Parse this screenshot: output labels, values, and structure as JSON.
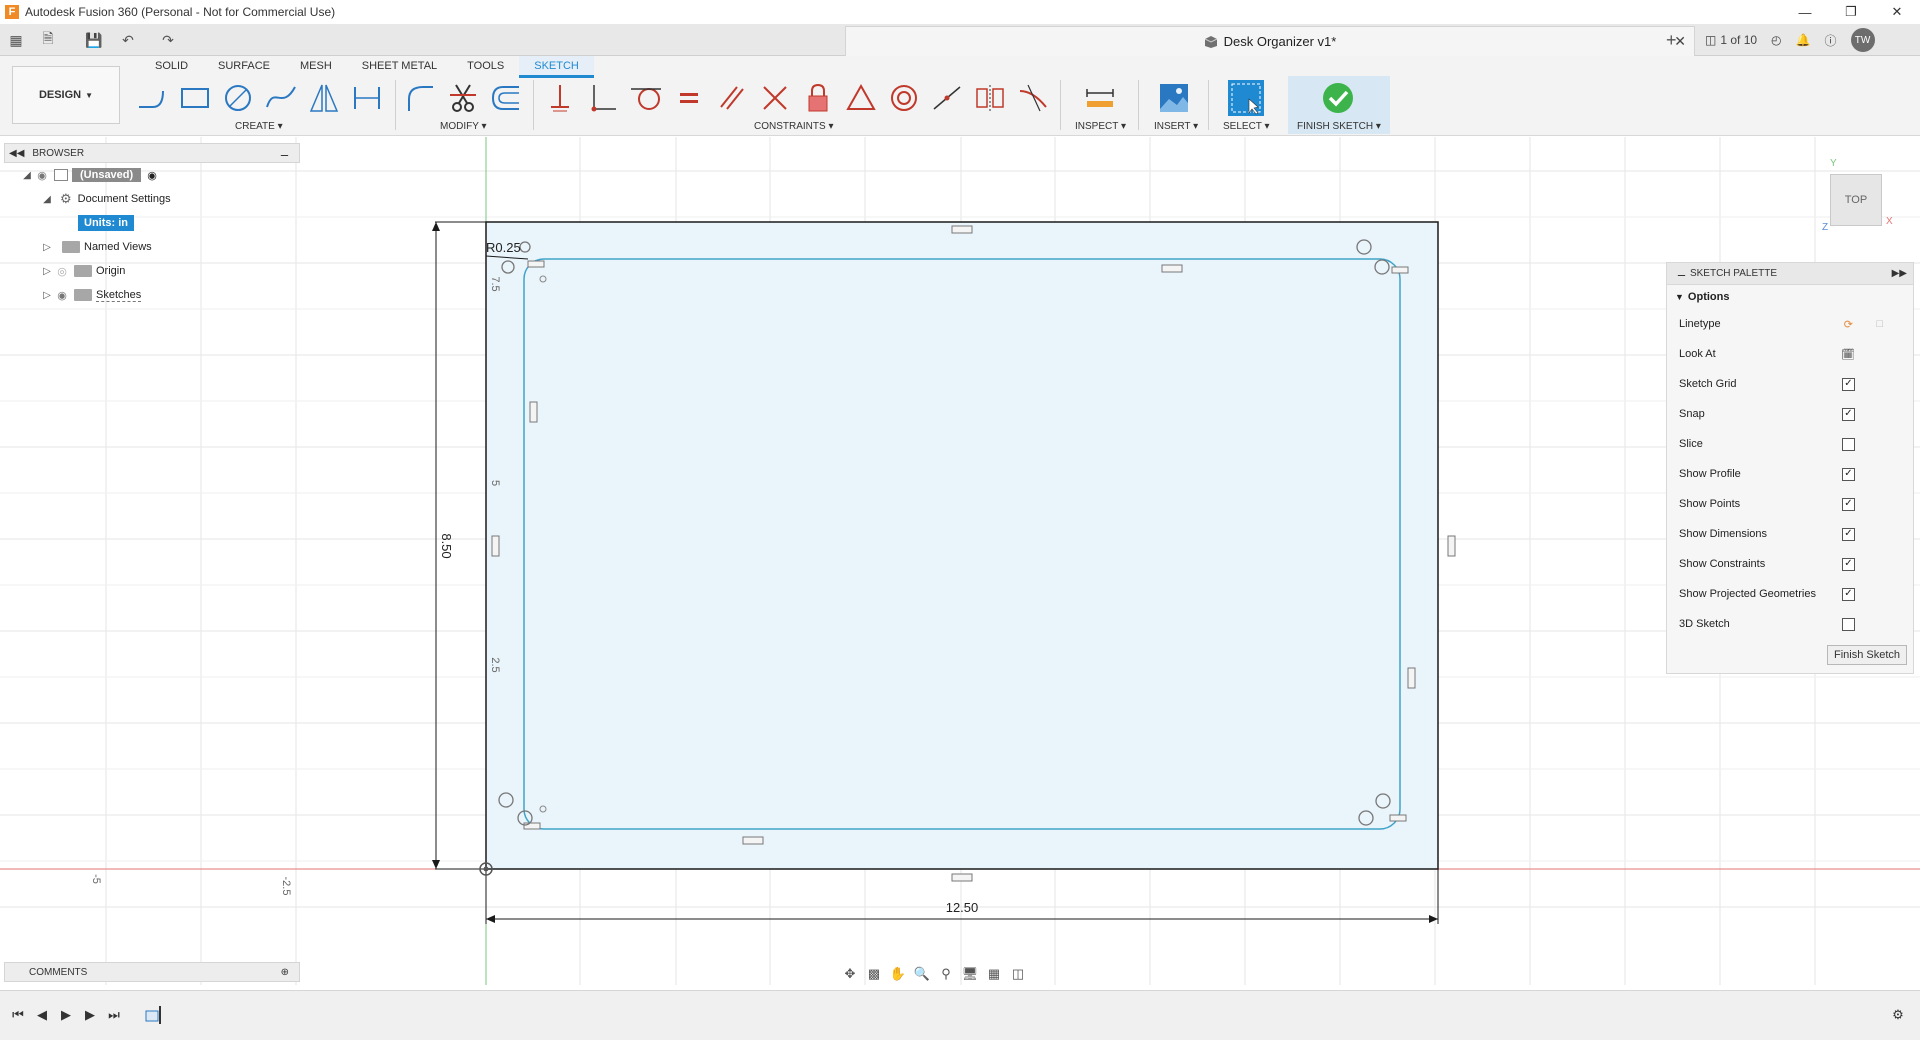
{
  "window": {
    "title": "Autodesk Fusion 360 (Personal - Not for Commercial Use)",
    "logo_letter": "F"
  },
  "doc_tab": {
    "title": "Desk Organizer v1*",
    "close": "✕",
    "new_tab": "+"
  },
  "topright": {
    "version_label": "1 of 10",
    "avatar": "TW"
  },
  "ribbon": {
    "workspace": "DESIGN",
    "tabs": [
      "SOLID",
      "SURFACE",
      "MESH",
      "SHEET METAL",
      "TOOLS",
      "SKETCH"
    ],
    "active_tab": "SKETCH",
    "groups": {
      "create": "CREATE",
      "modify": "MODIFY",
      "constraints": "CONSTRAINTS",
      "inspect": "INSPECT",
      "insert": "INSERT",
      "select": "SELECT",
      "finish": "FINISH SKETCH"
    }
  },
  "browser": {
    "header": "BROWSER",
    "root": "(Unsaved)",
    "document_settings": "Document Settings",
    "units": "Units: in",
    "named_views": "Named Views",
    "origin": "Origin",
    "sketches": "Sketches"
  },
  "comments": {
    "header": "COMMENTS"
  },
  "palette": {
    "header": "SKETCH PALETTE",
    "section": "Options",
    "rows": [
      {
        "label": "Linetype",
        "type": "icons"
      },
      {
        "label": "Look At",
        "type": "icon"
      },
      {
        "label": "Sketch Grid",
        "type": "checkbox",
        "checked": true
      },
      {
        "label": "Snap",
        "type": "checkbox",
        "checked": true
      },
      {
        "label": "Slice",
        "type": "checkbox",
        "checked": false
      },
      {
        "label": "Show Profile",
        "type": "checkbox",
        "checked": true
      },
      {
        "label": "Show Points",
        "type": "checkbox",
        "checked": true
      },
      {
        "label": "Show Dimensions",
        "type": "checkbox",
        "checked": true
      },
      {
        "label": "Show Constraints",
        "type": "checkbox",
        "checked": true
      },
      {
        "label": "Show Projected Geometries",
        "type": "checkbox",
        "checked": true
      },
      {
        "label": "3D Sketch",
        "type": "checkbox",
        "checked": false
      }
    ],
    "finish_button": "Finish Sketch"
  },
  "viewcube": {
    "face": "TOP",
    "axis_y": "Y",
    "axis_x": "X",
    "axis_z": "Z"
  },
  "sketch": {
    "dim_width": "12.50",
    "dim_height": "8.50",
    "dim_radius": "R0.25",
    "ruler_v_labels": [
      "7.5",
      "5",
      "2.5"
    ],
    "ruler_h_labels": [
      "-5",
      "-2.5"
    ]
  },
  "colors": {
    "accent": "#1f8ad2",
    "finish_green": "#3cb44b",
    "sketch_fill": "#eaf4fb",
    "sketch_line": "#3fa3c8",
    "axis_red": "#e57373",
    "axis_green": "#7bc47f"
  }
}
